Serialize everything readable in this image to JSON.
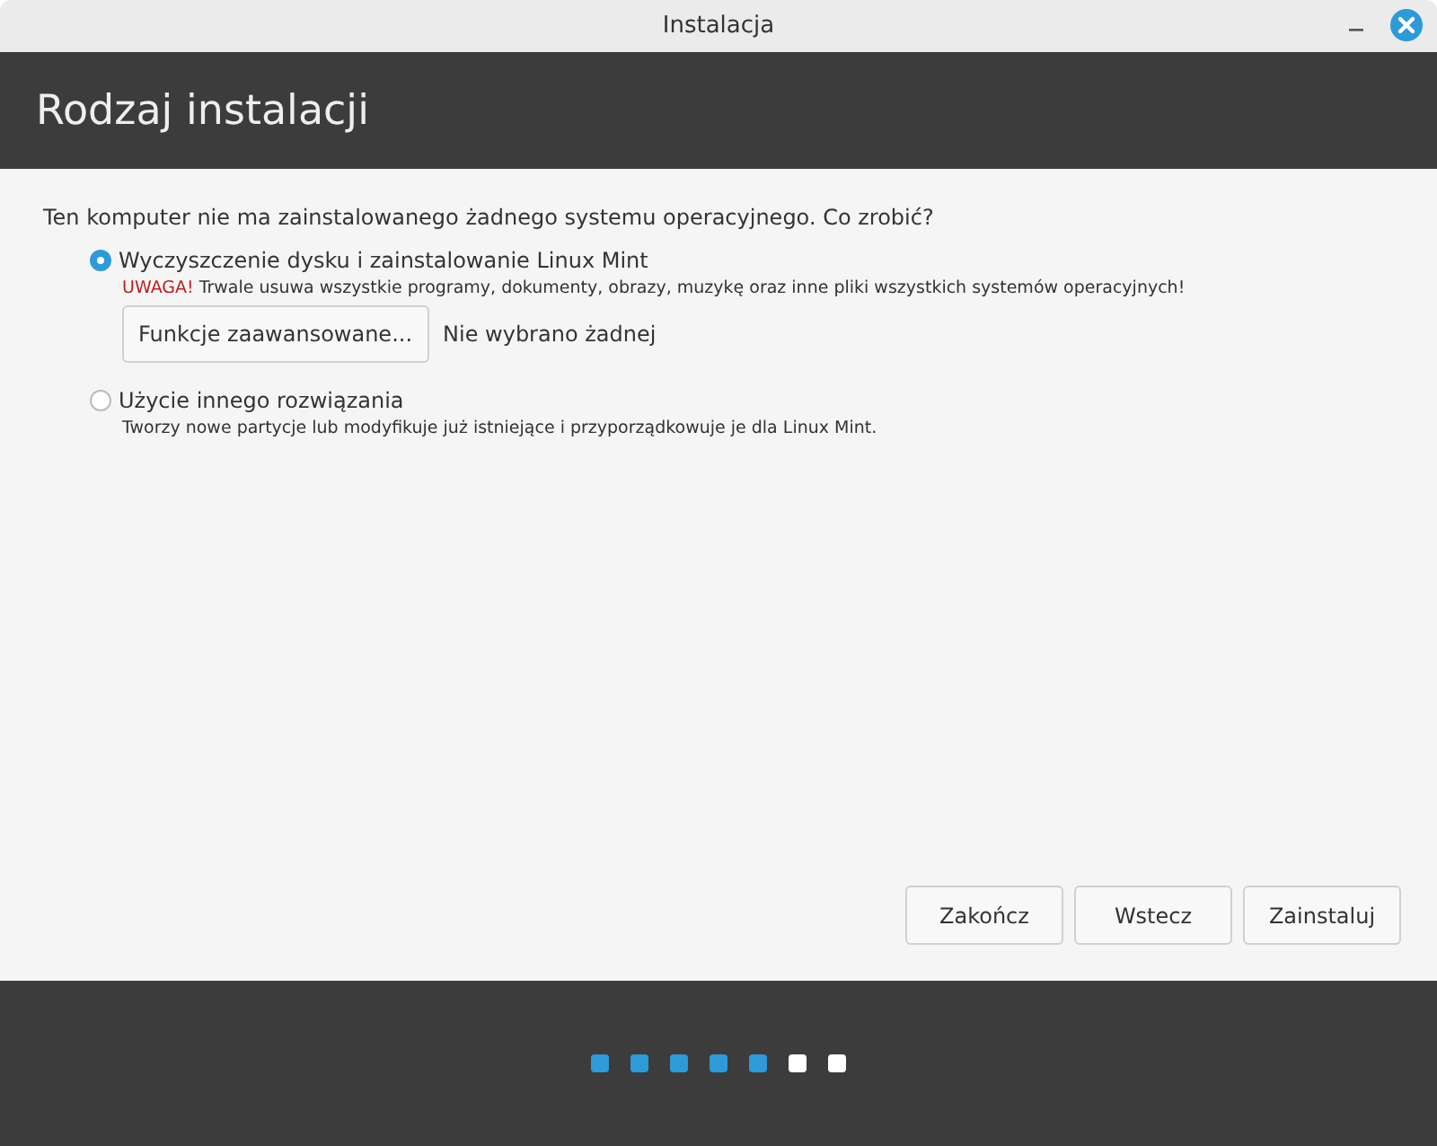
{
  "window": {
    "title": "Instalacja"
  },
  "header": {
    "title": "Rodzaj instalacji"
  },
  "question": "Ten komputer nie ma zainstalowanego żadnego systemu operacyjnego. Co zrobić?",
  "options": [
    {
      "label": "Wyczyszczenie dysku i zainstalowanie Linux Mint",
      "selected": true,
      "warning_label": "UWAGA!",
      "description": "Trwale usuwa wszystkie programy, dokumenty, obrazy, muzykę oraz inne pliki wszystkich systemów operacyjnych!",
      "advanced_button": "Funkcje zaawansowane...",
      "advanced_status": "Nie wybrano żadnej"
    },
    {
      "label": "Użycie innego rozwiązania",
      "selected": false,
      "description": "Tworzy nowe partycje lub modyfikuje już istniejące i przyporządkowuje je dla Linux Mint."
    }
  ],
  "buttons": [
    "Zakończ",
    "Wstecz",
    "Zainstaluj"
  ],
  "steps": [
    {
      "done": true
    },
    {
      "done": true
    },
    {
      "done": true
    },
    {
      "done": true
    },
    {
      "done": true
    },
    {
      "done": false
    },
    {
      "done": false
    }
  ]
}
